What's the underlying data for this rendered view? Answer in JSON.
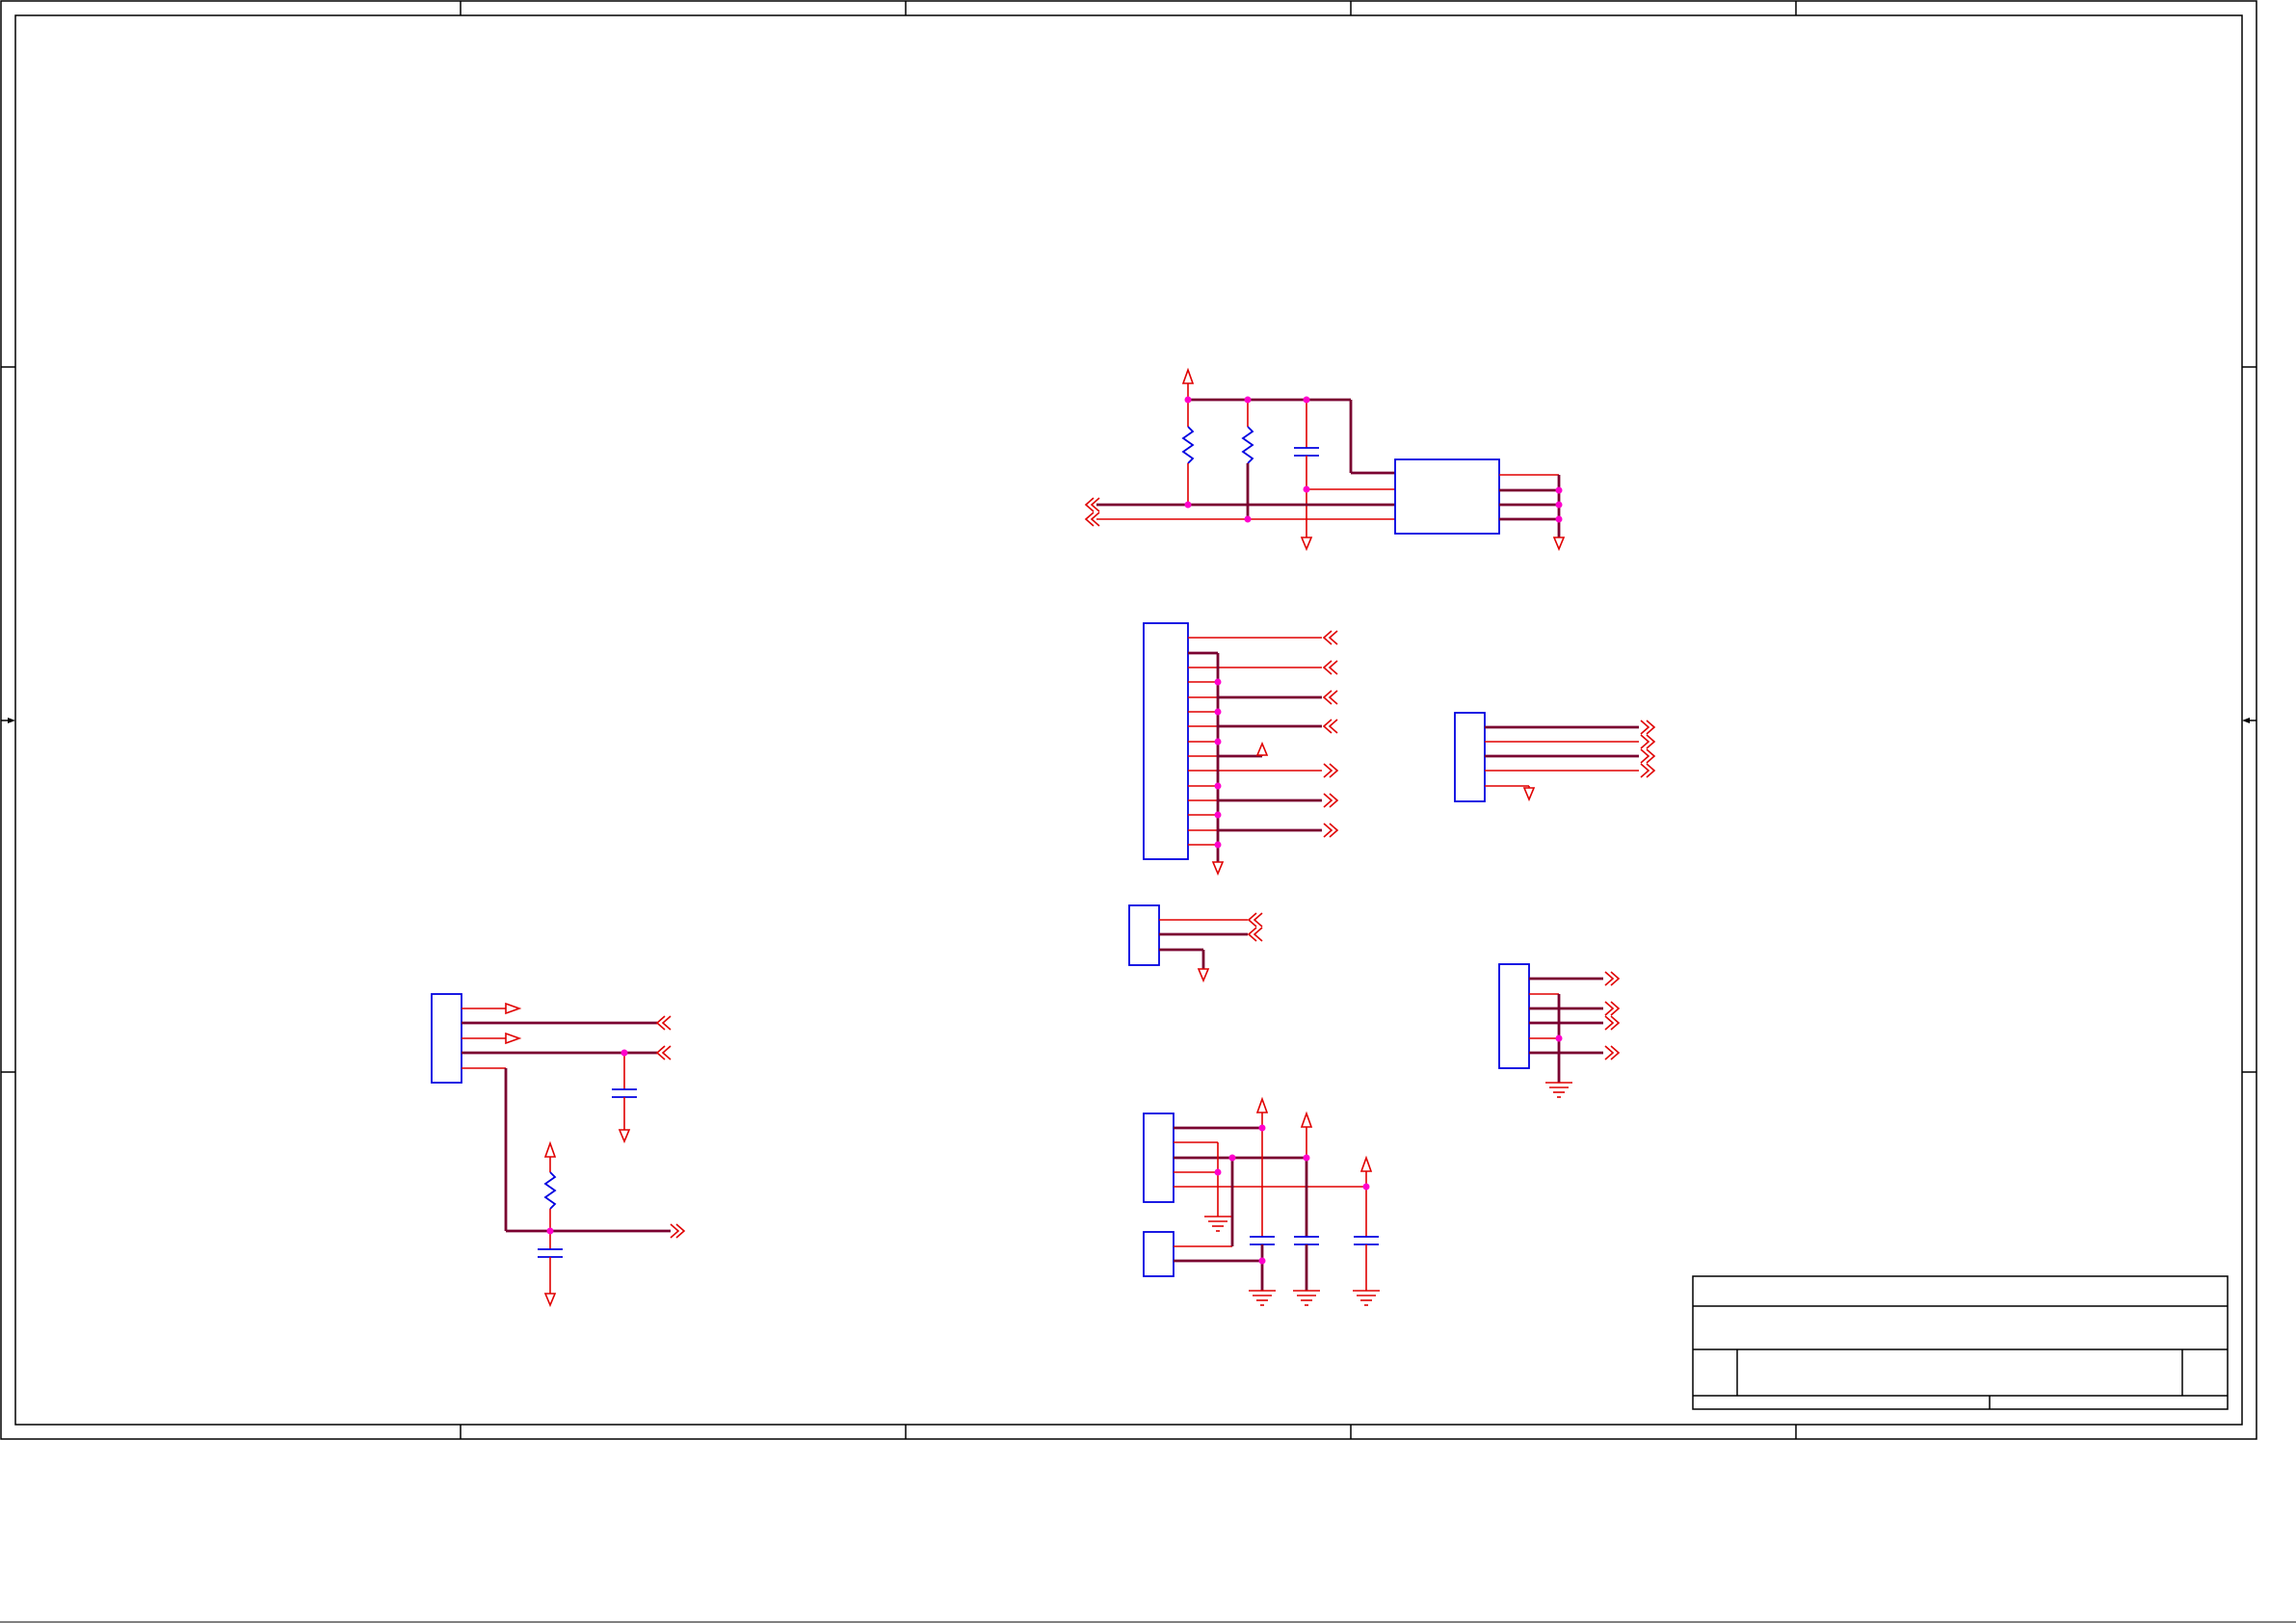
{
  "sheet": {
    "title_block": {
      "title": "",
      "document_number": "",
      "revision": "",
      "size": "",
      "date": "",
      "sheet": ""
    },
    "colors": {
      "wire": "#e00000",
      "bus": "#7a0030",
      "component": "#0000e0",
      "junction": "#ff00cc",
      "frame": "#000000"
    }
  }
}
